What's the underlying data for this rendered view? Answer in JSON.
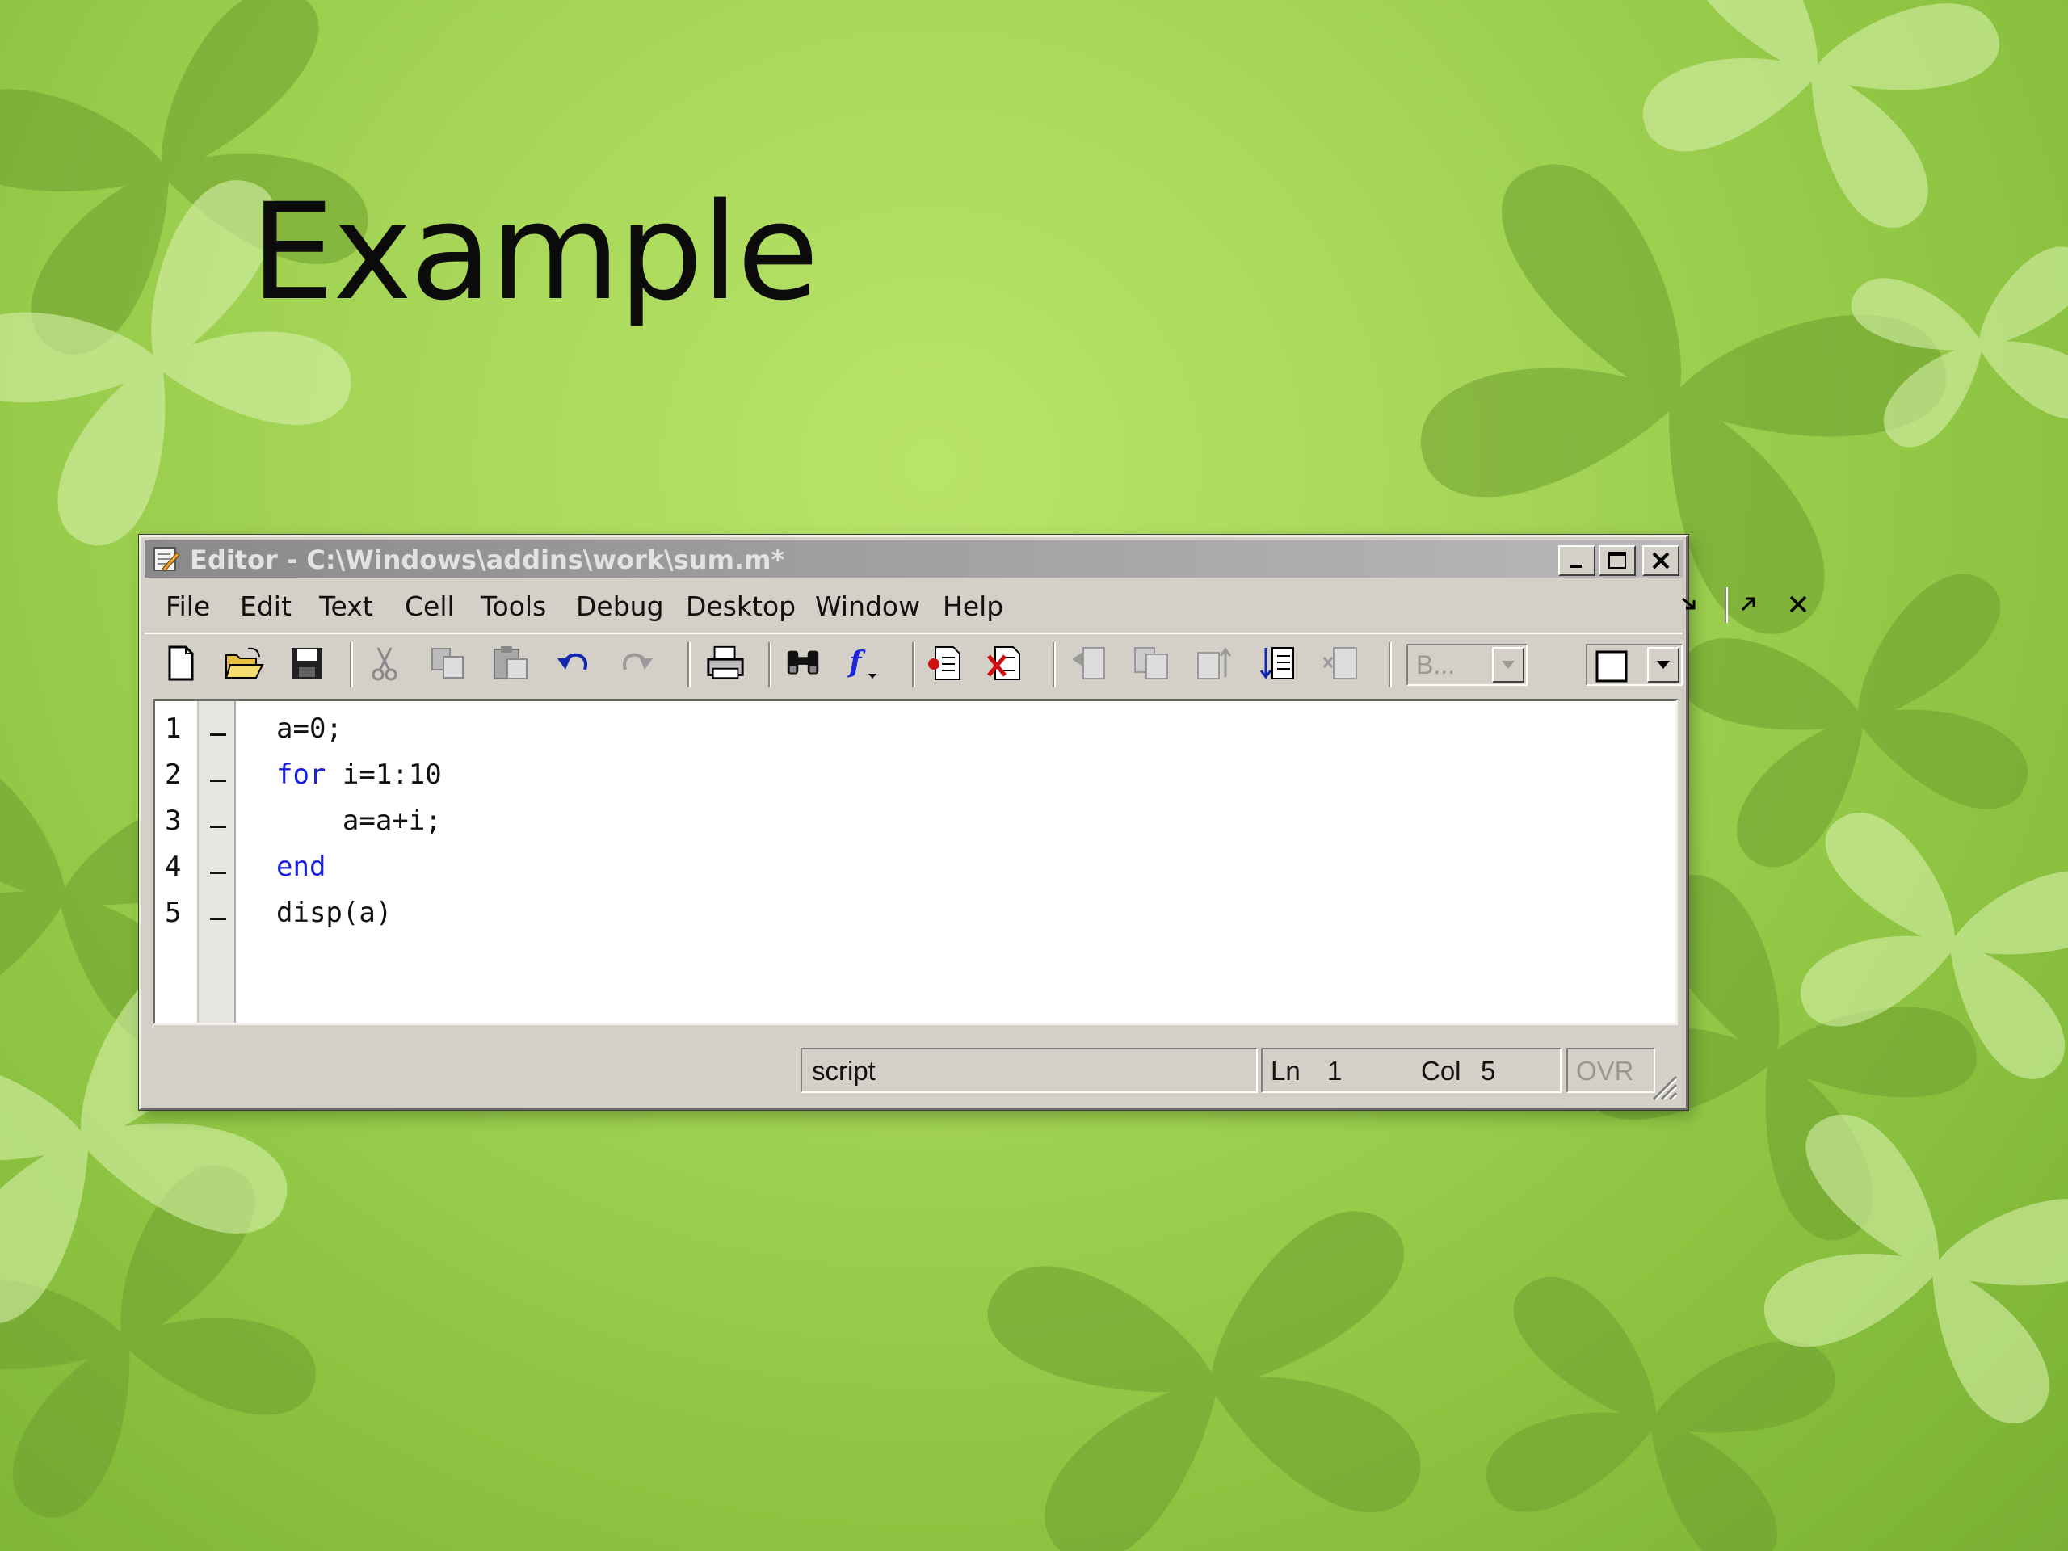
{
  "slide": {
    "title": "Example"
  },
  "window": {
    "title": "Editor - C:\\Windows\\addins\\work\\sum.m*",
    "controls": [
      "minimize-icon",
      "maximize-icon",
      "close-icon"
    ]
  },
  "menu": {
    "items": [
      "File",
      "Edit",
      "Text",
      "Cell",
      "Tools",
      "Debug",
      "Desktop",
      "Window",
      "Help"
    ],
    "right_icons": [
      "undock-icon",
      "dock-icon",
      "close-icon"
    ]
  },
  "toolbar": {
    "buttons": [
      "new-file-icon",
      "open-folder-icon",
      "save-icon",
      "cut-icon",
      "copy-icon",
      "paste-icon",
      "undo-icon",
      "redo-icon",
      "print-icon",
      "find-icon",
      "function-icon",
      "set-breakpoint-icon",
      "clear-breakpoints-icon",
      "step-icon",
      "step-in-icon",
      "step-out-icon",
      "continue-icon",
      "exit-debug-icon"
    ],
    "stack_combo": "B...",
    "layout_combo": ""
  },
  "editor": {
    "lines": [
      {
        "num": "1",
        "code": "a=0;",
        "indent": "",
        "keyword": ""
      },
      {
        "num": "2",
        "code": " i=1:10",
        "indent": "",
        "keyword": "for"
      },
      {
        "num": "3",
        "code": "a=a+i;",
        "indent": "    ",
        "keyword": ""
      },
      {
        "num": "4",
        "code": "",
        "indent": "",
        "keyword": "end"
      },
      {
        "num": "5",
        "code": "disp(a)",
        "indent": "",
        "keyword": ""
      }
    ],
    "keyword_color": "#1a20e0"
  },
  "status": {
    "mode": "script",
    "ln_label": "Ln",
    "ln_value": "1",
    "col_label": "Col",
    "col_value": "5",
    "ovr": "OVR"
  },
  "colors": {
    "background": "#a6d657",
    "window_face": "#d4d0c8",
    "titlebar": "#a0a0a0"
  }
}
